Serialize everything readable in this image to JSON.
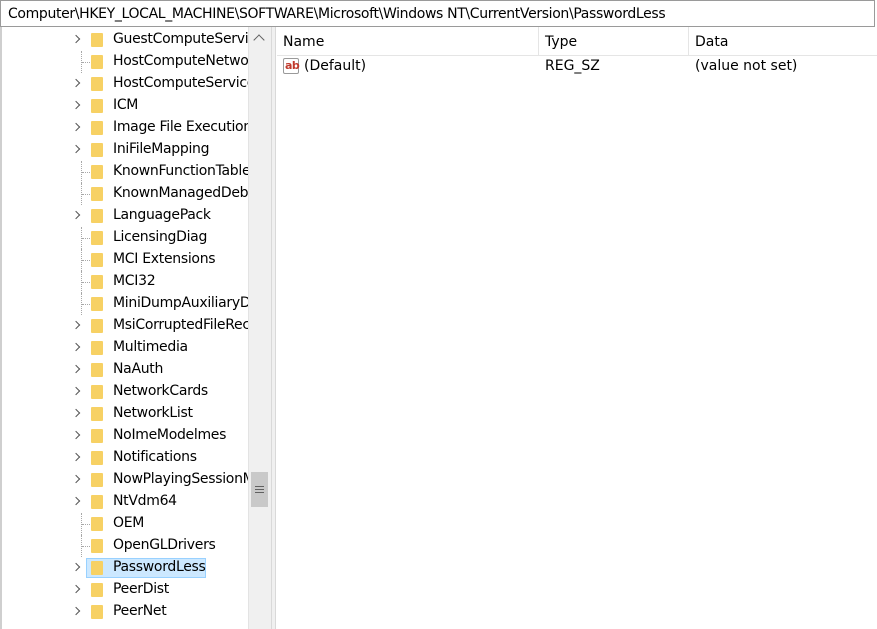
{
  "address_bar": {
    "path": "Computer\\HKEY_LOCAL_MACHINE\\SOFTWARE\\Microsoft\\Windows NT\\CurrentVersion\\PasswordLess"
  },
  "tree": {
    "items": [
      {
        "label": "GuestComputeService",
        "expandable": true
      },
      {
        "label": "HostComputeNetwork",
        "expandable": false
      },
      {
        "label": "HostComputeService",
        "expandable": true
      },
      {
        "label": "ICM",
        "expandable": true
      },
      {
        "label": "Image File Execution Options",
        "expandable": true
      },
      {
        "label": "IniFileMapping",
        "expandable": true
      },
      {
        "label": "KnownFunctionTableDlls",
        "expandable": false
      },
      {
        "label": "KnownManagedDebuggingDlls",
        "expandable": false
      },
      {
        "label": "LanguagePack",
        "expandable": true
      },
      {
        "label": "LicensingDiag",
        "expandable": false
      },
      {
        "label": "MCI Extensions",
        "expandable": false
      },
      {
        "label": "MCI32",
        "expandable": false
      },
      {
        "label": "MiniDumpAuxiliaryDlls",
        "expandable": false
      },
      {
        "label": "MsiCorruptedFileRecovery",
        "expandable": true
      },
      {
        "label": "Multimedia",
        "expandable": true
      },
      {
        "label": "NaAuth",
        "expandable": true
      },
      {
        "label": "NetworkCards",
        "expandable": true
      },
      {
        "label": "NetworkList",
        "expandable": true
      },
      {
        "label": "NoImeModelmes",
        "expandable": true
      },
      {
        "label": "Notifications",
        "expandable": true
      },
      {
        "label": "NowPlayingSessionManager",
        "expandable": true
      },
      {
        "label": "NtVdm64",
        "expandable": true
      },
      {
        "label": "OEM",
        "expandable": false
      },
      {
        "label": "OpenGLDrivers",
        "expandable": false
      },
      {
        "label": "PasswordLess",
        "expandable": true,
        "selected": true
      },
      {
        "label": "PeerDist",
        "expandable": true
      },
      {
        "label": "PeerNet",
        "expandable": true
      }
    ]
  },
  "list": {
    "columns": {
      "name": "Name",
      "type": "Type",
      "data": "Data"
    },
    "rows": [
      {
        "icon": "string-value-icon",
        "icon_text": "ab",
        "name": "(Default)",
        "type": "REG_SZ",
        "data": "(value not set)"
      }
    ]
  },
  "colors": {
    "selection_bg": "#cce8ff",
    "selection_border": "#99d1ff",
    "folder": "#f7d164",
    "scrollbar_bg": "#f0f0f0"
  }
}
